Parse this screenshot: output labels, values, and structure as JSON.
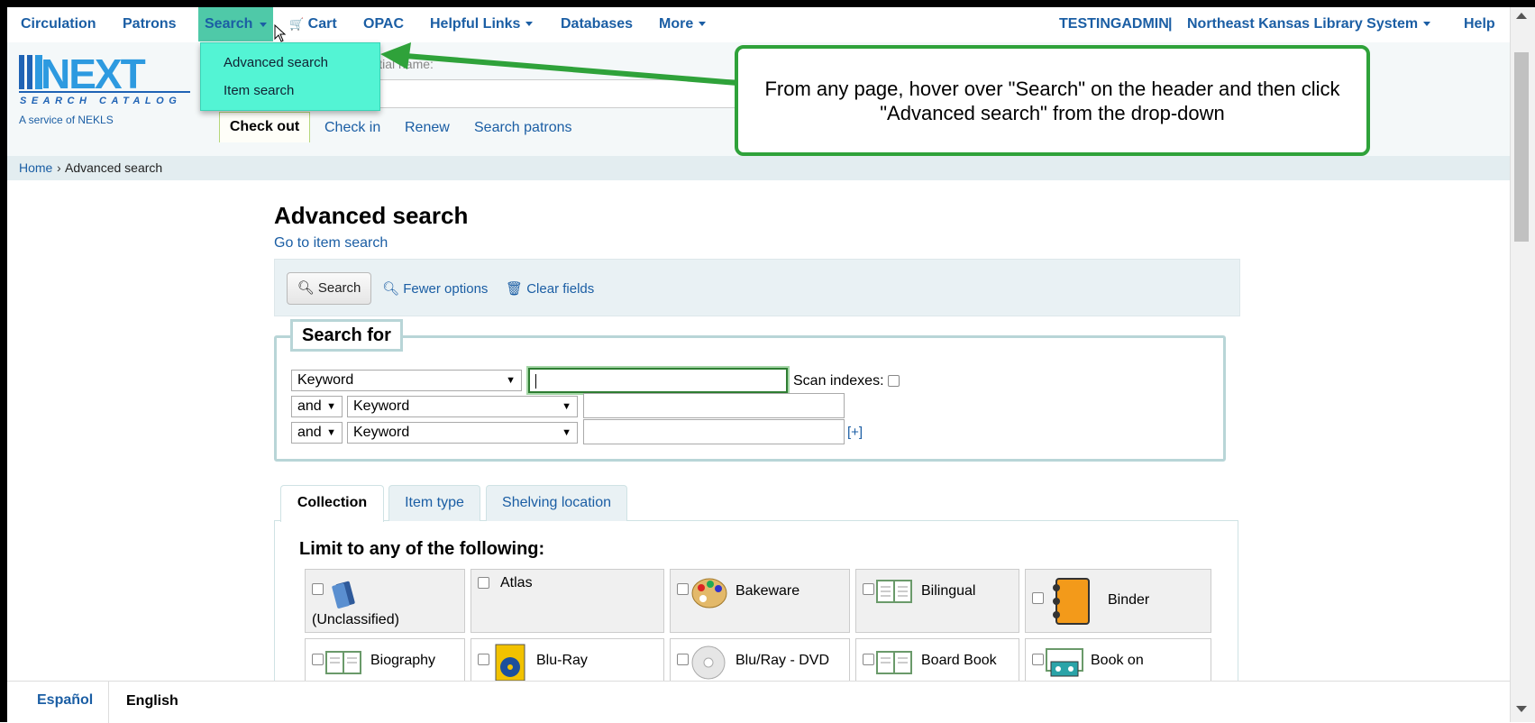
{
  "nav": {
    "circulation": "Circulation",
    "patrons": "Patrons",
    "search": "Search",
    "cart": "Cart",
    "opac": "OPAC",
    "helpful_links": "Helpful Links",
    "databases": "Databases",
    "more": "More",
    "user": "TESTINGADMIN",
    "separator": "|",
    "library": "Northeast Kansas Library System",
    "help": "Help"
  },
  "search_dropdown": [
    "Advanced search",
    "Item search"
  ],
  "header": {
    "logo_text": "NEXT",
    "logo_sub": "SEARCH CATALOG",
    "service": "A service of NEKLS",
    "hint": "partial name:",
    "checkout": "Check out",
    "checkin": "Check in",
    "renew": "Renew",
    "search_patrons": "Search patrons"
  },
  "callout": "From any page, hover over \"Search\" on the header and then click \"Advanced search\" from the drop-down",
  "breadcrumb": {
    "home": "Home",
    "sep": "›",
    "current": "Advanced search"
  },
  "main": {
    "title": "Advanced search",
    "go_item": "Go to item search",
    "search_btn": "Search",
    "fewer": "Fewer options",
    "clear": "Clear fields"
  },
  "search_for": {
    "legend": "Search for",
    "field1": "Keyword",
    "op2": "and",
    "field2": "Keyword",
    "op3": "and",
    "field3": "Keyword",
    "scan": "Scan indexes:",
    "add": "[+]"
  },
  "tabs": [
    "Collection",
    "Item type",
    "Shelving location"
  ],
  "limit_title": "Limit to any of the following:",
  "collections": [
    "(Unclassified)",
    "Atlas",
    "Bakeware",
    "Bilingual",
    "Binder",
    "Biography",
    "Blu-Ray",
    "Blu/Ray - DVD",
    "Board Book",
    "Book on"
  ],
  "footer": {
    "espanol": "Español",
    "english": "English"
  },
  "colors": {
    "link": "#1b5ea4",
    "accent": "#4fc9a8",
    "callout_border": "#2fa23a",
    "dropdown": "#53f4d4"
  }
}
